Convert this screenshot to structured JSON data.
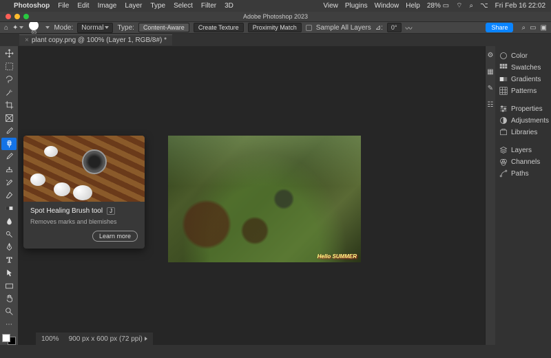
{
  "menubar": {
    "app": "Photoshop",
    "items": [
      "File",
      "Edit",
      "Image",
      "Layer",
      "Type",
      "Select",
      "Filter",
      "3D"
    ],
    "right_items": [
      "View",
      "Plugins",
      "Window",
      "Help"
    ],
    "battery": "28%",
    "clock": "Fri Feb 16  22:02"
  },
  "window": {
    "title": "Adobe Photoshop 2023"
  },
  "options": {
    "brush_size": "65",
    "mode_label": "Mode:",
    "mode_value": "Normal",
    "type_label": "Type:",
    "type_buttons": [
      "Content-Aware",
      "Create Texture",
      "Proximity Match"
    ],
    "sample_label": "Sample All Layers",
    "angle_label": "⊿:",
    "angle_value": "0°",
    "share": "Share"
  },
  "tab": {
    "label": "plant copy.png @ 100% (Layer 1, RGB/8#) *"
  },
  "tooltip": {
    "title": "Spot Healing Brush tool",
    "key": "J",
    "desc": "Removes marks and blemishes",
    "learn": "Learn more"
  },
  "canvas": {
    "watermark": "Hello SUMMER"
  },
  "panels": {
    "items": [
      "Color",
      "Swatches",
      "Gradients",
      "Patterns",
      "Properties",
      "Adjustments",
      "Libraries",
      "Layers",
      "Channels",
      "Paths"
    ]
  },
  "status": {
    "zoom": "100%",
    "dims": "900 px x 600 px (72 ppi)"
  },
  "tools": [
    "move",
    "marquee",
    "lasso",
    "wand",
    "crop",
    "frame",
    "eyedrop",
    "heal",
    "brush",
    "stamp",
    "history",
    "eraser",
    "gradient",
    "blur",
    "dodge",
    "pen",
    "type",
    "path",
    "rect",
    "hand",
    "zoom",
    "more"
  ]
}
